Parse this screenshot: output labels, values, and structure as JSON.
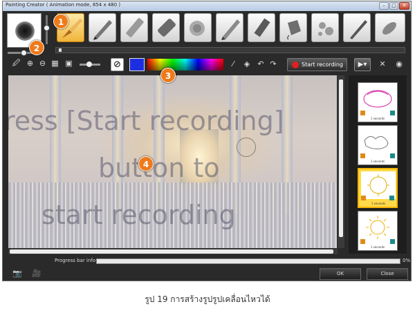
{
  "window": {
    "title": "Painting Creator ( Animation mode, 854 x 480 )",
    "buttons": [
      "–",
      "□",
      "✕"
    ]
  },
  "tools": [
    {
      "name": "paint-brush-tool",
      "selected": true
    },
    {
      "name": "pen-tool"
    },
    {
      "name": "marker-tool"
    },
    {
      "name": "eraser-tool"
    },
    {
      "name": "blur-tool"
    },
    {
      "name": "pencil-tool"
    },
    {
      "name": "crayon-tool"
    },
    {
      "name": "bucket-tool"
    },
    {
      "name": "splatter-tool"
    },
    {
      "name": "feather-brush-tool"
    },
    {
      "name": "smudge-tool"
    }
  ],
  "toolbar": {
    "record_label": "Start recording",
    "color_swatch": "#1c2fe0"
  },
  "canvas": {
    "overlay_lines": [
      "ress [Start recording]",
      "button to",
      "start recording"
    ]
  },
  "frames": [
    {
      "caption": "1 seconds",
      "selected": false
    },
    {
      "caption": "1 seconds",
      "selected": false
    },
    {
      "caption": "1 seconds",
      "selected": true
    },
    {
      "caption": "1 seconds",
      "selected": false
    }
  ],
  "progress": {
    "label": "Progress bar info",
    "percent": "0%",
    "value": 0
  },
  "buttons": {
    "ok": "OK",
    "close": "Close"
  },
  "callouts": [
    "1",
    "2",
    "3",
    "4"
  ],
  "caption": "รูป 19 การสร้างรูปรูปเคลื่อนไหวได้",
  "colors": {
    "accent": "#ef7a1a",
    "record": "#e02020",
    "frame_selected": "#ffd94a"
  }
}
